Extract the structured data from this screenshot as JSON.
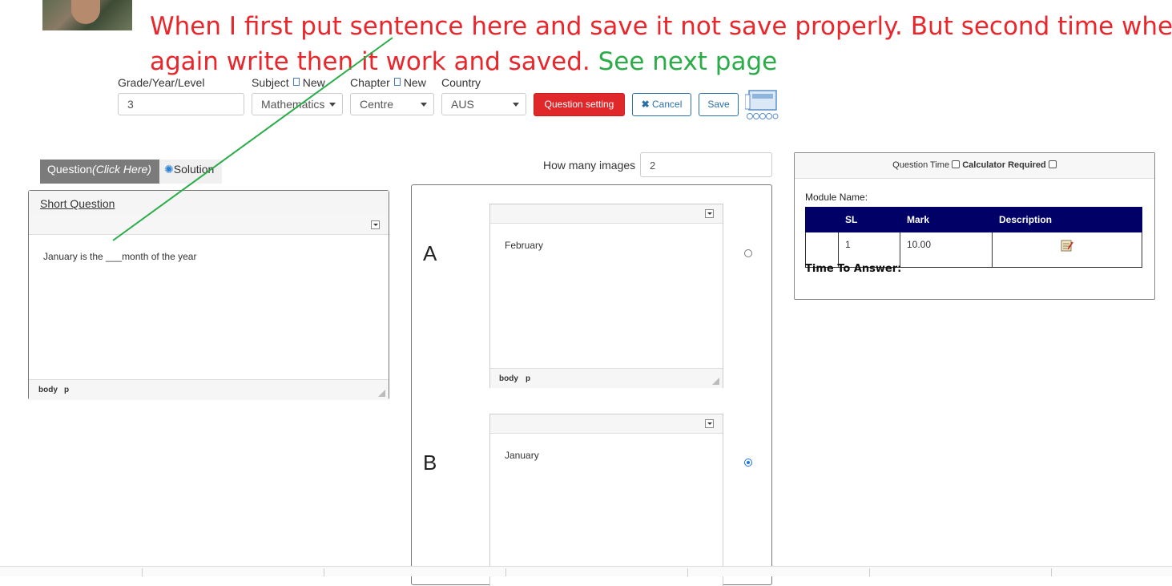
{
  "annotation": {
    "line1": "When I first put sentence here and save it not save properly. But second time when I",
    "line2_red": "again write then it work and saved.",
    "line2_green": "See next page"
  },
  "toolbar": {
    "grade_label": "Grade/Year/Level",
    "grade_value": "3",
    "subject_label": "Subject",
    "subject_new": "New",
    "subject_value": "Mathematics",
    "chapter_label": "Chapter",
    "chapter_new": "New",
    "chapter_value": "Centre",
    "country_label": "Country",
    "country_value": "AUS",
    "question_setting": "Question setting",
    "cancel": "Cancel",
    "save": "Save"
  },
  "tabs": {
    "question_prefix": "Question",
    "question_hint": "(Click Here)",
    "solution": "Solution"
  },
  "question_editor": {
    "title": "Short Question",
    "content": "January is the ___month of the year",
    "status_body": "body",
    "status_p": "p"
  },
  "answers": {
    "images_label": "How many images",
    "images_value": "2",
    "options": [
      {
        "letter": "A",
        "text": "February",
        "selected": false,
        "status_body": "body",
        "status_p": "p"
      },
      {
        "letter": "B",
        "text": "January",
        "selected": true
      }
    ]
  },
  "settings": {
    "question_time": "Question Time",
    "calculator_required": "Calculator Required",
    "module_name": "Module Name:",
    "columns": [
      "SL",
      "Mark",
      "Description"
    ],
    "rows": [
      {
        "sl": "1",
        "mark": "10.00",
        "description": "edit-note-icon"
      }
    ],
    "time_to_answer": "Time To Answer:"
  },
  "colors": {
    "accent_red": "#e0282b",
    "outline_blue": "#2a6fa8",
    "table_header": "#000066",
    "annotation_red": "#e8262b",
    "annotation_green": "#2aac48"
  }
}
